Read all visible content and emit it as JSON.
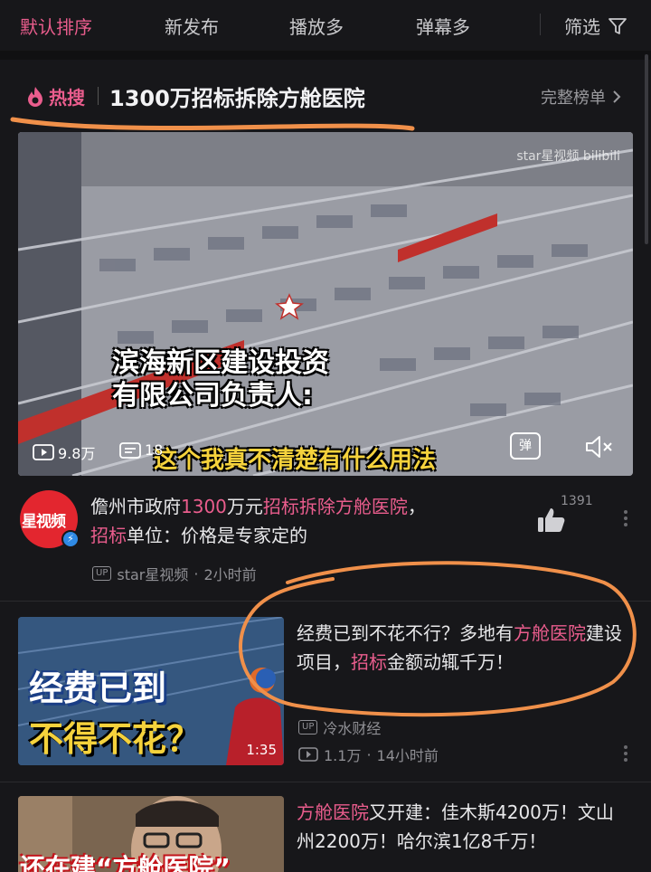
{
  "sort_tabs": [
    {
      "label": "默认排序",
      "active": true
    },
    {
      "label": "新发布",
      "active": false
    },
    {
      "label": "播放多",
      "active": false
    },
    {
      "label": "弹幕多",
      "active": false
    }
  ],
  "filter_label": "筛选",
  "hot_search": {
    "badge": "热搜",
    "title": "1300万招标拆除方舱医院",
    "more": "完整榜单"
  },
  "main_video": {
    "watermark": "star星视频 bilibili",
    "caption_line1": "滨海新区建设投资",
    "caption_line2": "有限公司负责人:",
    "caption_bottom": "这个我真不清楚有什么用法",
    "views": "9.8万",
    "danmaku": "18",
    "danmaku_icon_label": "弹",
    "avatar_text": "星视频",
    "title_parts": [
      "儋州市政府",
      "1300",
      "万元",
      "招标拆除方舱医院",
      "，",
      "招标",
      "单位：价格是专家定的"
    ],
    "up_tag": "UP",
    "author": "star星视频",
    "time": "2小时前",
    "likes": "1391"
  },
  "items": [
    {
      "thumb_line1": "经费已到",
      "thumb_line2": "不得不花？",
      "duration": "1:35",
      "title_parts": [
        "经费已到不花不行？多地有",
        "方舱医院",
        "建设项目，",
        "招标",
        "金额动辄千万！"
      ],
      "author": "冷水财经",
      "views": "1.1万",
      "time": "14小时前"
    },
    {
      "thumb_text": "还在建“方舱医院”",
      "title_parts": [
        "方舱医院",
        "又开建：佳木斯4200万！文山州2200万！哈尔滨1亿8千万！"
      ]
    }
  ],
  "colors": {
    "accent": "#ea5d8d",
    "annotation": "#f0904a",
    "background": "#17171a"
  }
}
